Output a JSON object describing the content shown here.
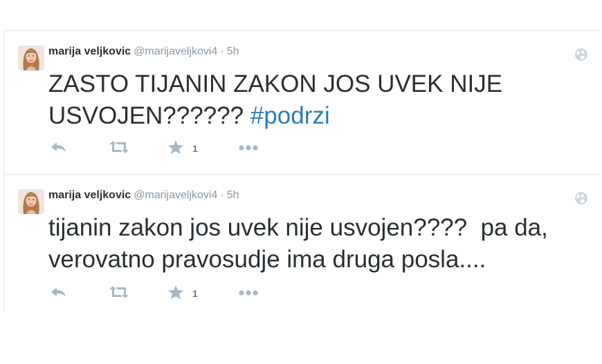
{
  "tweets": [
    {
      "fullname": "marija veljkovic",
      "username": "@marijaveljkovi4",
      "separator": "·",
      "time": "5h",
      "text_main": "ZASTO TIJANIN ZAKON JOS UVEK NIJE USVOJEN??????",
      "hashtag": "#podrzi",
      "favorite_count": "1",
      "icons": [
        "avatar",
        "globe-icon",
        "reply-icon",
        "retweet-icon",
        "star-icon",
        "more-icon"
      ]
    },
    {
      "fullname": "marija veljkovic",
      "username": "@marijaveljkovi4",
      "separator": "·",
      "time": "5h",
      "text_main": "tijanin zakon jos uvek nije usvojen????  pa da, verovatno pravosudje ima druga posla....",
      "hashtag": "",
      "favorite_count": "1",
      "icons": [
        "avatar",
        "globe-icon",
        "reply-icon",
        "retweet-icon",
        "star-icon",
        "more-icon"
      ]
    }
  ],
  "colors": {
    "text": "#292f33",
    "meta": "#8899a6",
    "hashtag": "#2b7bb9",
    "action_icon": "#aab8c2",
    "divider": "#e1e8ed"
  }
}
